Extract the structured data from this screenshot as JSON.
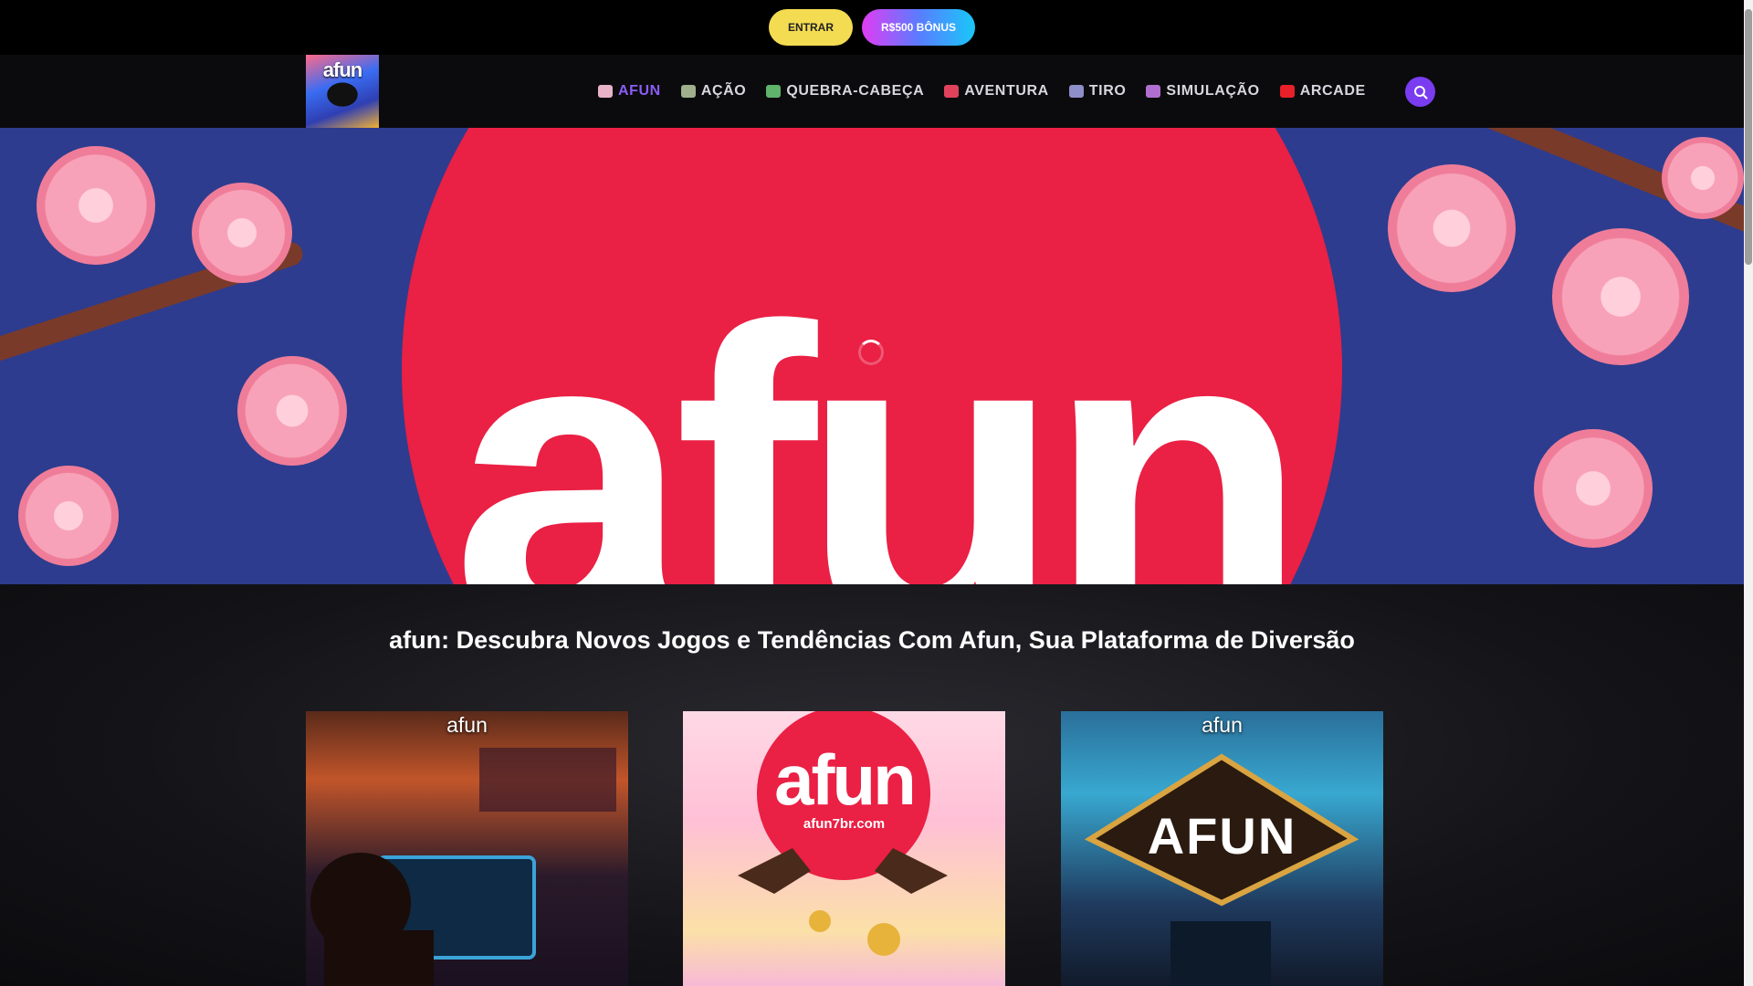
{
  "topbar": {
    "enter_label": "ENTRAR",
    "bonus_label": "R$500 BÔNUS"
  },
  "logo": {
    "text": "afun"
  },
  "nav": {
    "items": [
      {
        "label": "AFUN",
        "icon": "home-icon",
        "active": true
      },
      {
        "label": "AÇÃO",
        "icon": "turtle-icon"
      },
      {
        "label": "QUEBRA-CABEÇA",
        "icon": "puzzle-icon"
      },
      {
        "label": "AVENTURA",
        "icon": "cube-icon"
      },
      {
        "label": "TIRO",
        "icon": "gamepad-icon"
      },
      {
        "label": "SIMULAÇÃO",
        "icon": "robot-icon"
      },
      {
        "label": "ARCADE",
        "icon": "play-icon"
      }
    ],
    "search_icon": "search-icon"
  },
  "hero": {
    "word": "afun"
  },
  "main": {
    "title": "afun: Descubra Novos Jogos e Tendências Com Afun, Sua Plataforma de Diversão",
    "cards": [
      {
        "label": "afun"
      },
      {
        "label": "afun",
        "headline": "afun",
        "url_text": "afun7br.com"
      },
      {
        "label": "afun",
        "sign_text": "AFUN"
      }
    ]
  },
  "colors": {
    "accent_purple": "#8c5cf6",
    "enter_yellow": "#f4dc52",
    "hero_sky": "#2d3c8e",
    "hero_moon": "#ea2044"
  }
}
